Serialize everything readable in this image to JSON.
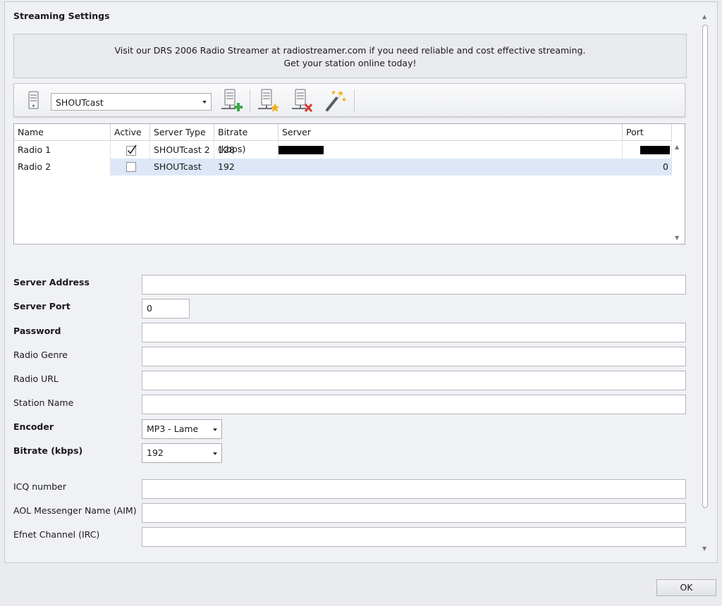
{
  "header": {
    "title": "Streaming Settings"
  },
  "banner": {
    "line1": "Visit our DRS 2006 Radio Streamer at radiostreamer.com if you need reliable and cost effective streaming.",
    "line2": "Get your station online today!"
  },
  "toolbar": {
    "server_type_selected": "SHOUTcast",
    "icons": [
      "server-icon",
      "add-server-icon",
      "favorite-server-icon",
      "delete-server-icon",
      "wizard-icon"
    ]
  },
  "grid": {
    "columns": [
      "Name",
      "Active",
      "Server Type",
      "Bitrate (kbps)",
      "Server",
      "Port"
    ],
    "rows": [
      {
        "name": "Radio 1",
        "active": true,
        "server_type": "SHOUTcast 2",
        "bitrate": "128",
        "server": "",
        "port": ""
      },
      {
        "name": "Radio 2",
        "active": false,
        "server_type": "SHOUTcast",
        "bitrate": "192",
        "server": "",
        "port": "0"
      }
    ]
  },
  "form": {
    "server_address": {
      "label": "Server Address",
      "value": ""
    },
    "server_port": {
      "label": "Server Port",
      "value": "0"
    },
    "password": {
      "label": "Password",
      "value": ""
    },
    "radio_genre": {
      "label": "Radio Genre",
      "value": ""
    },
    "radio_url": {
      "label": "Radio URL",
      "value": ""
    },
    "station_name": {
      "label": "Station Name",
      "value": ""
    },
    "encoder": {
      "label": "Encoder",
      "value": "MP3 - Lame"
    },
    "bitrate": {
      "label": "Bitrate (kbps)",
      "value": "192"
    },
    "icq": {
      "label": "ICQ number",
      "value": ""
    },
    "aim": {
      "label": "AOL Messenger Name (AIM)",
      "value": ""
    },
    "irc": {
      "label": "Efnet Channel (IRC)",
      "value": ""
    }
  },
  "footer": {
    "ok_label": "OK"
  },
  "colors": {
    "selected_row": "#dde7f7",
    "panel_bg": "#f0f1f4",
    "add_green": "#3aa84a",
    "delete_red": "#d23a2f",
    "favorite_gold": "#f2b01e"
  }
}
